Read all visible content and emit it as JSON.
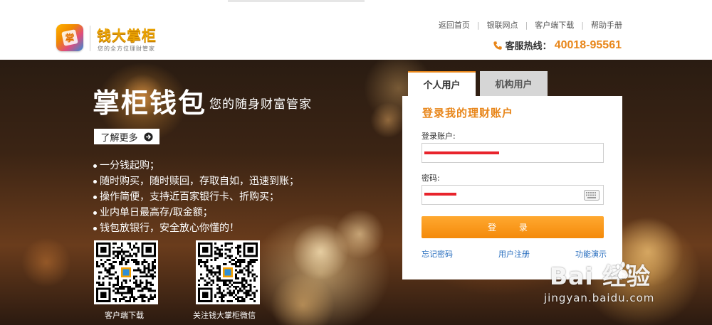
{
  "header": {
    "logo_name": "钱大掌柜",
    "logo_slogan": "您的全方位理财管家",
    "nav": [
      "返回首页",
      "银联网点",
      "客户端下载",
      "帮助手册"
    ],
    "hotline_label": "客服热线：",
    "hotline_number": "40018-95561"
  },
  "hero": {
    "title": "掌柜钱包",
    "subtitle": "您的随身财富管家",
    "learn_more": "了解更多",
    "features": [
      "一分钱起购；",
      "随时购买，随时赎回，存取自如，迅速到账；",
      "操作简便，支持近百家银行卡、折购买；",
      "业内单日最高存/取金额；",
      "钱包放银行，安全放心你懂的！"
    ],
    "qr_codes": [
      {
        "caption": "客户端下载"
      },
      {
        "caption": "关注钱大掌柜微信"
      }
    ]
  },
  "login": {
    "tabs": [
      "个人用户",
      "机构用户"
    ],
    "heading": "登录我的理财账户",
    "account_label": "登录账户:",
    "account_value": "",
    "password_label": "密码:",
    "password_value": "",
    "login_button": "登 录",
    "links": [
      "忘记密码",
      "用户注册",
      "功能演示"
    ]
  },
  "watermark": {
    "brand": "Bai  经验",
    "url": "jingyan.baidu.com"
  },
  "colors": {
    "accent": "#e8861a",
    "link": "#2a6fbf",
    "redaction": "#e8242c"
  }
}
